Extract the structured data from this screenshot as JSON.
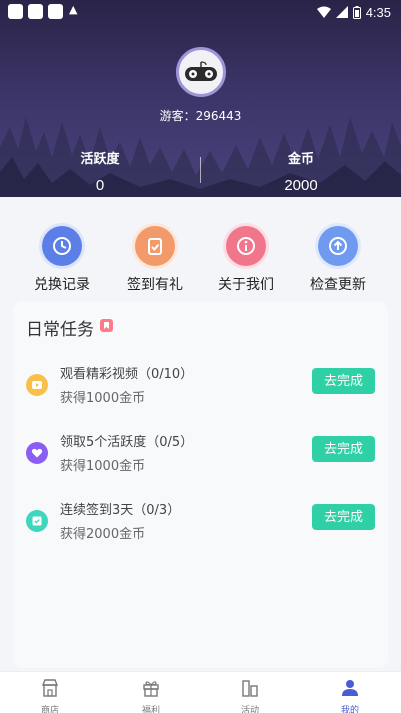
{
  "status_bar": {
    "time": "4:35"
  },
  "profile": {
    "guest_label": "游客：296443",
    "activity_label": "活跃度",
    "activity_value": "0",
    "coins_label": "金币",
    "coins_value": "2000"
  },
  "actions": [
    {
      "label": "兑换记录",
      "icon": "clock-icon",
      "color": "#5b7fe6"
    },
    {
      "label": "签到有礼",
      "icon": "clipboard-check-icon",
      "color": "#f29a6a"
    },
    {
      "label": "关于我们",
      "icon": "info-icon",
      "color": "#f0768c"
    },
    {
      "label": "检查更新",
      "icon": "upload-arrow-icon",
      "color": "#6f9af0"
    }
  ],
  "tasks_card": {
    "title": "日常任务",
    "items": [
      {
        "title": "观看精彩视频（0/10）",
        "reward": "获得1000金币",
        "button": "去完成",
        "icon": "video-icon",
        "color": "#f8c04a"
      },
      {
        "title": "领取5个活跃度（0/5）",
        "reward": "获得1000金币",
        "button": "去完成",
        "icon": "heart-icon",
        "color": "#8a5ef2"
      },
      {
        "title": "连续签到3天（0/3）",
        "reward": "获得2000金币",
        "button": "去完成",
        "icon": "calendar-check-icon",
        "color": "#3fd6c0"
      }
    ]
  },
  "bottom_nav": {
    "items": [
      {
        "label": "商店",
        "icon": "store-icon"
      },
      {
        "label": "福利",
        "icon": "gift-icon"
      },
      {
        "label": "活动",
        "icon": "activity-icon"
      },
      {
        "label": "我的",
        "icon": "user-icon"
      }
    ],
    "active_color": "#4b5bd6"
  }
}
